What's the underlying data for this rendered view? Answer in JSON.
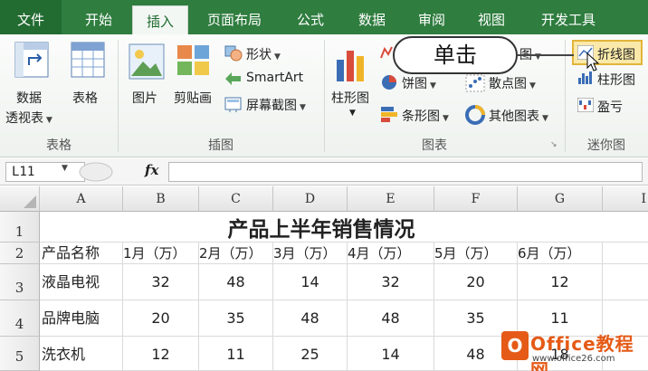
{
  "ribbon": {
    "tabs": [
      "文件",
      "开始",
      "插入",
      "页面布局",
      "公式",
      "数据",
      "审阅",
      "视图",
      "开发工具"
    ],
    "active_tab": "插入",
    "groups": {
      "tables": {
        "label": "表格",
        "pivot_line1": "数据",
        "pivot_line2": "透视表",
        "table": "表格"
      },
      "illustrations": {
        "label": "插图",
        "picture": "图片",
        "clipart": "剪贴画",
        "shapes": "形状",
        "smartart": "SmartArt",
        "screenshot": "屏幕截图"
      },
      "charts": {
        "label": "图表",
        "column": "柱形图",
        "line_partial": "图",
        "pie": "饼图",
        "bar": "条形图",
        "area_partial": "图",
        "scatter": "散点图",
        "other": "其他图表"
      },
      "sparklines": {
        "label": "迷你图",
        "line": "折线图",
        "column": "柱形图",
        "winloss": "盈亏"
      }
    }
  },
  "callout": {
    "text": "单击"
  },
  "formula_bar": {
    "name_box": "L11",
    "fx": "fx",
    "value": ""
  },
  "sheet": {
    "columns": [
      "A",
      "B",
      "C",
      "D",
      "E",
      "F",
      "G"
    ],
    "partial_column": "I",
    "row_numbers": [
      "1",
      "2",
      "3",
      "4",
      "5"
    ],
    "title": "产品上半年销售情况",
    "headers": [
      "产品名称",
      "1月（万）",
      "2月（万）",
      "3月（万）",
      "4月（万）",
      "5月（万）",
      "6月（万）"
    ],
    "rows": [
      {
        "name": "液晶电视",
        "values": [
          "32",
          "48",
          "14",
          "32",
          "20",
          "12"
        ]
      },
      {
        "name": "品牌电脑",
        "values": [
          "20",
          "35",
          "48",
          "48",
          "35",
          "11"
        ]
      },
      {
        "name": "洗衣机",
        "values": [
          "12",
          "11",
          "25",
          "14",
          "48",
          "18"
        ]
      }
    ]
  },
  "watermark": {
    "brand": "Office教程网",
    "logo_letter": "O",
    "url": "www.office26.com"
  },
  "colors": {
    "ribbon_green": "#2f7d3f",
    "accent_orange": "#e55a16",
    "highlight": "#fbe9a9"
  }
}
